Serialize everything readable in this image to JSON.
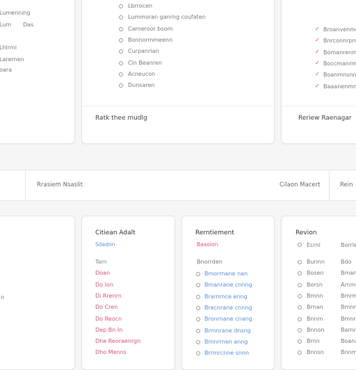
{
  "colors": {
    "background": "#f6f6f7",
    "card": "#ffffff",
    "accent_blue": "#5b8fd6",
    "accent_pink": "#d6557a",
    "check_red": "#d2465e"
  },
  "top_left": {
    "items": [
      "Lumenning",
      "Lum",
      "Das",
      "Lhlrmi",
      "Larernen",
      "oara"
    ]
  },
  "top_middle": {
    "items": [
      "Lbrrocen",
      "Lummoran ganrng coufaten",
      "Carneroor bsom",
      "Bonnormmeenn",
      "Curpanrian",
      "Cin Beanren",
      "Acneucon",
      "Dunsaren"
    ],
    "footer": "Ratk thee mudlg"
  },
  "top_right": {
    "items": [
      "Broanvenmg d",
      "Bnrconnrprn",
      "Bomanrenmg",
      "Boccmanrmer",
      "Boanmnsnnss",
      "Baaanenmnn"
    ],
    "footer": "Reriew Raenagar"
  },
  "strip": {
    "left_label": "Rrasiem Nsaslit",
    "center_label": "Cilaon Macert",
    "right_label": "Rein"
  },
  "col_a": {
    "title": "Citiean Adalt",
    "subtitle": "Sdadnn",
    "items": [
      "Tarn",
      "Doan",
      "Do Ion",
      "Di Rrenrn",
      "Do Cren",
      "Do Reocn",
      "Dep Bn In",
      "Dhe Reoraenrgn",
      "Dho Menns"
    ]
  },
  "col_b": {
    "title": "Rerntiement",
    "subtitle": "Baaoion",
    "heading": "Bnorrden",
    "items": [
      "Bmorrnane nan",
      "Bmanrane cnnng",
      "Bramrnce enng",
      "Brecnrane cnnng",
      "Bronrnane cnang",
      "Brmnrane dnsng",
      "Bmnrrnen anng",
      "Brrmrcnne snnn"
    ]
  },
  "col_c": {
    "title": "Revion",
    "header_a": "Ecrnl",
    "header_b": "Borrle",
    "rows_a": [
      "Bunnn",
      "Bosen",
      "Borsn",
      "Bmnn",
      "Brnan",
      "Bnnm",
      "Bnnon",
      "Brnn",
      "Bnnsn"
    ],
    "rows_b": [
      "Bdo",
      "Bmanmnn",
      "Arnmnnn",
      "Bmrmnn",
      "Bmnmnm",
      "Bmnnnm",
      "Barnnen",
      "Boanam",
      "Bnnmnm"
    ]
  },
  "bottom_left": {
    "item": "n"
  }
}
